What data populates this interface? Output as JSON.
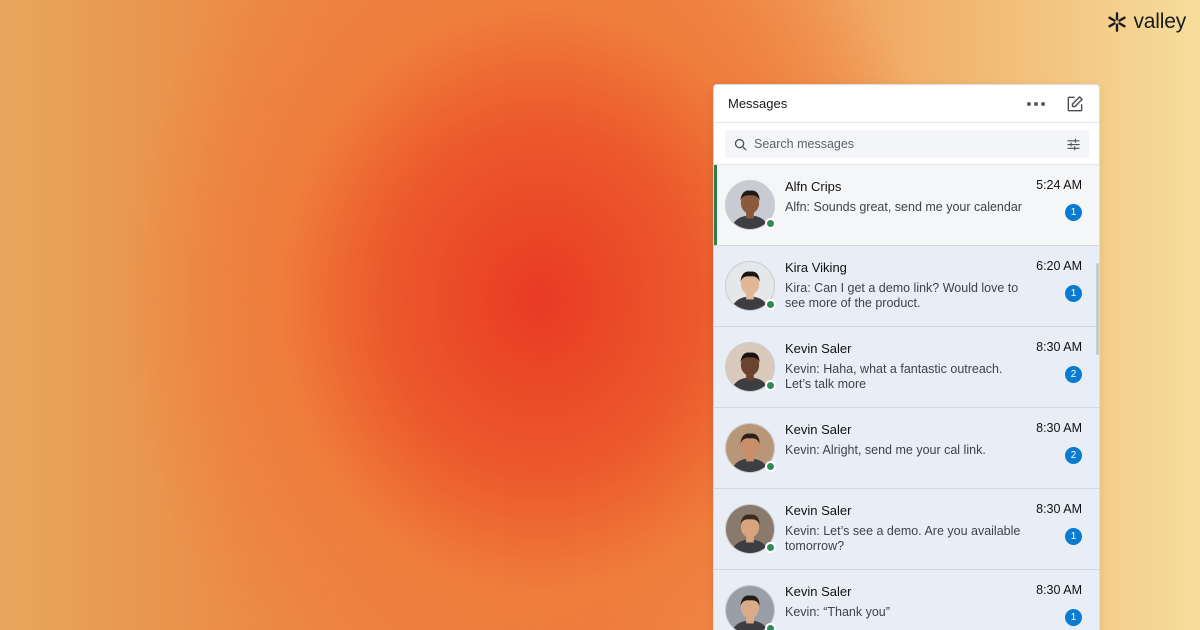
{
  "brand": {
    "name": "valley",
    "icon": "asterisk-logo-icon"
  },
  "panel": {
    "title": "Messages",
    "more_icon": "more-horizontal-icon",
    "compose_icon": "compose-icon",
    "search": {
      "placeholder": "Search messages",
      "value": "",
      "icon": "search-icon",
      "filter_icon": "filter-sliders-icon"
    }
  },
  "colors": {
    "accent": "#2f7d4f",
    "badge": "#0a7bd0",
    "presence": "#2e8b57",
    "item_bg": "#e9eef6"
  },
  "conversations": [
    {
      "name": "Alfn Crips",
      "preview": "Alfn: Sounds great, send me your calendar",
      "time": "5:24 AM",
      "unread": "1",
      "active": true,
      "online": true
    },
    {
      "name": "Kira Viking",
      "preview": "Kira:  Can I get a demo link? Would love to see more of the product.",
      "time": "6:20 AM",
      "unread": "1",
      "active": false,
      "online": true
    },
    {
      "name": "Kevin Saler",
      "preview": "Kevin:  Haha, what a fantastic outreach. Let’s talk more",
      "time": "8:30 AM",
      "unread": "2",
      "active": false,
      "online": true
    },
    {
      "name": "Kevin Saler",
      "preview": "Kevin:  Alright, send me your cal link.",
      "time": "8:30 AM",
      "unread": "2",
      "active": false,
      "online": true
    },
    {
      "name": "Kevin Saler",
      "preview": "Kevin:  Let’s see a demo. Are you available tomorrow?",
      "time": "8:30 AM",
      "unread": "1",
      "active": false,
      "online": true
    },
    {
      "name": "Kevin Saler",
      "preview": "Kevin:  “Thank you”",
      "time": "8:30 AM",
      "unread": "1",
      "active": false,
      "online": true
    }
  ]
}
